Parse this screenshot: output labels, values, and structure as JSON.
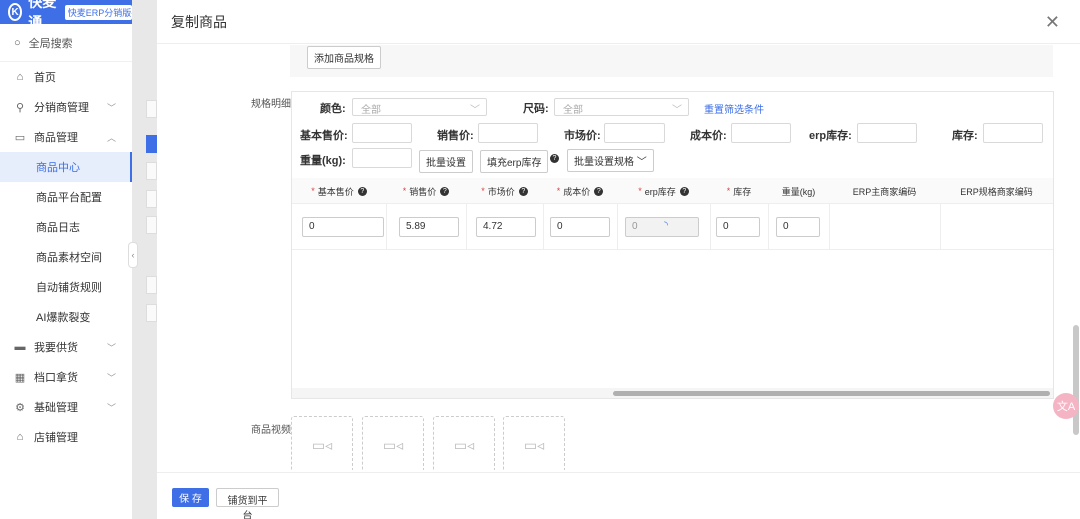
{
  "brand": {
    "logo": "K",
    "name": "快麦通",
    "badge": "快麦ERP分销版-供"
  },
  "sidebar": {
    "search": "全局搜索",
    "home": "首页",
    "distributor": "分销商管理",
    "product_mgmt": "商品管理",
    "subs": [
      "商品中心",
      "商品平台配置",
      "商品日志",
      "商品素材空间",
      "自动铺货规则",
      "AI爆款裂变"
    ],
    "supply": "我要供货",
    "stall": "档口拿货",
    "basic": "基础管理",
    "shop": "店铺管理"
  },
  "modal": {
    "title": "复制商品",
    "add_spec": "添加商品规格",
    "spec_detail_label": "规格明细",
    "color_label": "颜色:",
    "color_value": "全部",
    "size_label": "尺码:",
    "size_value": "全部",
    "reset_filter": "重置筛选条件",
    "batch": {
      "base_price": "基本售价:",
      "sale_price": "销售价:",
      "market_price": "市场价:",
      "cost_price": "成本价:",
      "erp_stock": "erp库存:",
      "stock": "库存:",
      "weight": "重量(kg):",
      "batch_set": "批量设置",
      "fill_erp": "填充erp库存",
      "batch_spec": "批量设置规格"
    },
    "table": {
      "headers": [
        "基本售价",
        "销售价",
        "市场价",
        "成本价",
        "erp库存",
        "库存",
        "重量(kg)",
        "ERP主商家编码",
        "ERP规格商家编码"
      ],
      "row": {
        "base_price": "0",
        "sale_price": "5.89",
        "market_price": "4.72",
        "cost_price": "0",
        "erp_stock": "0",
        "stock": "0",
        "weight": "0"
      }
    },
    "video_label": "商品视频",
    "save": "保 存",
    "distribute": "铺货到平台"
  },
  "float_button": "文A",
  "colors": {
    "primary": "#3e6fe6",
    "required": "#e04040"
  }
}
